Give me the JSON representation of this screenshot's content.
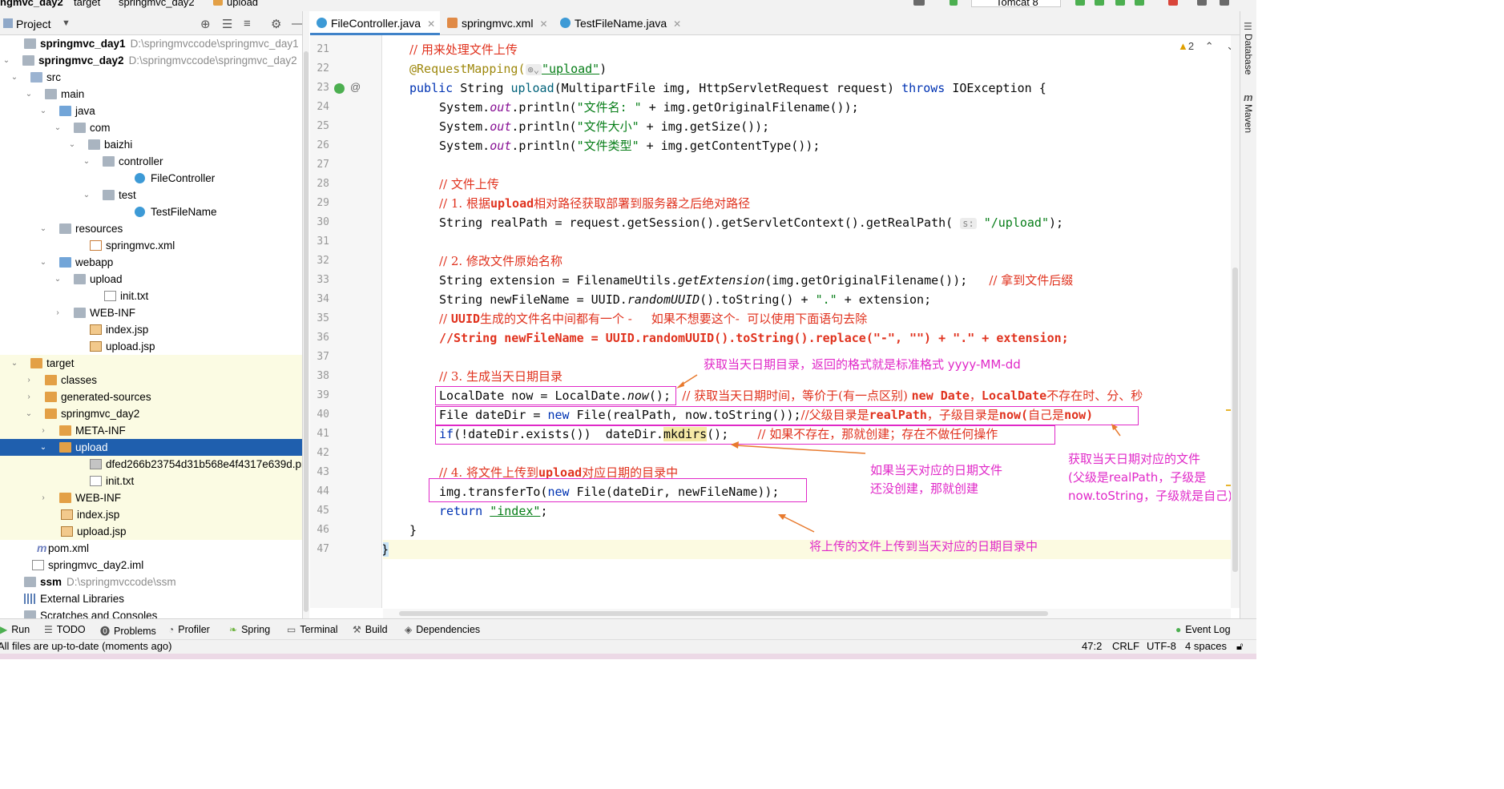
{
  "topbar": {
    "project_crumb": "ngmvc_day2",
    "crumb2": "target",
    "crumb3": "springmvc_day2",
    "crumb4": "upload",
    "run_config": "Tomcat 8"
  },
  "project_panel": {
    "title": "Project",
    "tree": [
      {
        "label": "springmvc_day1",
        "path": "D:\\springmvccode\\springmvc_day1",
        "bold": true
      },
      {
        "label": "springmvc_day2",
        "path": "D:\\springmvccode\\springmvc_day2",
        "bold": true
      },
      {
        "label": "src"
      },
      {
        "label": "main"
      },
      {
        "label": "java"
      },
      {
        "label": "com"
      },
      {
        "label": "baizhi"
      },
      {
        "label": "controller"
      },
      {
        "label": "FileController"
      },
      {
        "label": "test"
      },
      {
        "label": "TestFileName"
      },
      {
        "label": "resources"
      },
      {
        "label": "springmvc.xml"
      },
      {
        "label": "webapp"
      },
      {
        "label": "upload"
      },
      {
        "label": "init.txt"
      },
      {
        "label": "WEB-INF"
      },
      {
        "label": "index.jsp"
      },
      {
        "label": "upload.jsp"
      },
      {
        "label": "target"
      },
      {
        "label": "classes"
      },
      {
        "label": "generated-sources"
      },
      {
        "label": "springmvc_day2"
      },
      {
        "label": "META-INF"
      },
      {
        "label": "upload"
      },
      {
        "label": "dfed266b23754d31b568e4f4317e639d.png"
      },
      {
        "label": "init.txt"
      },
      {
        "label": "WEB-INF"
      },
      {
        "label": "index.jsp"
      },
      {
        "label": "upload.jsp"
      },
      {
        "label": "pom.xml"
      },
      {
        "label": "springmvc_day2.iml"
      },
      {
        "label": "ssm",
        "path": "D:\\springmvccode\\ssm",
        "bold": true
      },
      {
        "label": "External Libraries"
      },
      {
        "label": "Scratches and Consoles"
      }
    ]
  },
  "tabs": [
    {
      "label": "FileController.java",
      "active": true
    },
    {
      "label": "springmvc.xml",
      "active": false
    },
    {
      "label": "TestFileName.java",
      "active": false
    }
  ],
  "editor": {
    "warnings": "2",
    "line_numbers": [
      "21",
      "22",
      "23",
      "24",
      "25",
      "26",
      "27",
      "28",
      "29",
      "30",
      "31",
      "32",
      "33",
      "34",
      "35",
      "36",
      "37",
      "38",
      "39",
      "40",
      "41",
      "42",
      "43",
      "44",
      "45",
      "46",
      "47"
    ],
    "code": {
      "l21": "// 用来处理文件上传",
      "l22_ann": "@RequestMapping(",
      "l22_val": "\"upload\"",
      "l22_end": ")",
      "l23_kw1": "public",
      "l23_a": " String ",
      "l23_fn": "upload",
      "l23_b": "(MultipartFile img, HttpServletRequest request) ",
      "l23_kw2": "throws",
      "l23_c": " IOException {",
      "l24_a": "System.",
      "l24_f": "out",
      "l24_b": ".println(",
      "l24_s": "\"文件名: \"",
      "l24_c": " + img.getOriginalFilename());",
      "l25_s": "\"文件大小\"",
      "l25_c": " + img.getSize());",
      "l26_s": "\"文件类型\"",
      "l26_c": " + img.getContentType());",
      "l28": "// 文件上传",
      "l29_a": "// 1. 根据",
      "l29_b": "upload",
      "l29_c": "相对路径获取部署到服务器之后绝对路径",
      "l30_a": "String realPath = request.getSession().getServletContext().getRealPath( ",
      "l30_hint": "s:",
      "l30_s": " \"/upload\"",
      "l30_c": ");",
      "l32": "// 2. 修改文件原始名称",
      "l33_a": "String extension = FilenameUtils.",
      "l33_it": "getExtension",
      "l33_b": "(img.getOriginalFilename());   ",
      "l33_cm": "// 拿到文件后缀",
      "l34_a": "String newFileName = UUID.",
      "l34_it": "randomUUID",
      "l34_b": "().toString() + ",
      "l34_s": "\".\"",
      "l34_c": " + extension;",
      "l35_a": "// ",
      "l35_b": "UUID",
      "l35_c": "生成的文件名中间都有一个 -     如果不想要这个-  可以使用下面语句去除",
      "l36": "//String newFileName = UUID.randomUUID().toString().replace(\"-\", \"\") + \".\" + extension;",
      "l38": "// 3. 生成当天日期目录",
      "l39_a": "LocalDate now = LocalDate.",
      "l39_it": "now",
      "l39_b": "();",
      "l39_cm1": "   // 获取当天日期时间，等价于(有一点区别) ",
      "l39_cm2": "new Date",
      "l39_cm3": "，",
      "l39_cm4": "LocalDate",
      "l39_cm5": "不存在时、分、秒",
      "l40_a": "File dateDir = ",
      "l40_kw": "new",
      "l40_b": " File(realPath, now.toString());",
      "l40_cm1": "//父级目录是",
      "l40_cm2": "realPath",
      "l40_cm3": "，子级目录是",
      "l40_cm4": "now(",
      "l40_cm5": "自己是",
      "l40_cm6": "now)",
      "l41_kw": "if",
      "l41_a": "(!dateDir.exists())  dateDir.",
      "l41_b": "mkdirs",
      "l41_c": "();    ",
      "l41_cm": "// 如果不存在，那就创建；存在不做任何操作",
      "l43_a": "// 4. 将文件上传到",
      "l43_b": "upload",
      "l43_c": "对应日期的目录中",
      "l44_a": "img.transferTo(",
      "l44_kw": "new",
      "l44_b": " File(dateDir, newFileName));",
      "l45_kw": "return",
      "l45_s": "\"index\"",
      "l45_c": ";",
      "l46": "}",
      "l47": "}"
    }
  },
  "annotations": {
    "a1": "获取当天日期目录，返回的格式就是标准格式   yyyy-MM-dd",
    "a2_l1": "如果当天对应的日期文件",
    "a2_l2": "还没创建，那就创建",
    "a3_l1": "获取当天日期对应的文件",
    "a3_l2": "(父级是realPath，子级是",
    "a3_l3": "now.toString，子级就是自己)",
    "a4": "将上传的文件上传到当天对应的日期目录中"
  },
  "right_strip": {
    "database": "Database",
    "maven": "Maven"
  },
  "bottom_tools": [
    "Run",
    "TODO",
    "Problems",
    "Profiler",
    "Spring",
    "Terminal",
    "Build",
    "Dependencies",
    "Event Log"
  ],
  "status": {
    "message": "All files are up-to-date (moments ago)",
    "position": "47:2",
    "line_sep": "CRLF",
    "encoding": "UTF-8",
    "indent": "4 spaces"
  },
  "colors": {
    "accent": "#1f5fae",
    "annotation": "#e029c8",
    "keyword": "#0033b3",
    "string": "#067d17",
    "comment": "#e0321e"
  }
}
